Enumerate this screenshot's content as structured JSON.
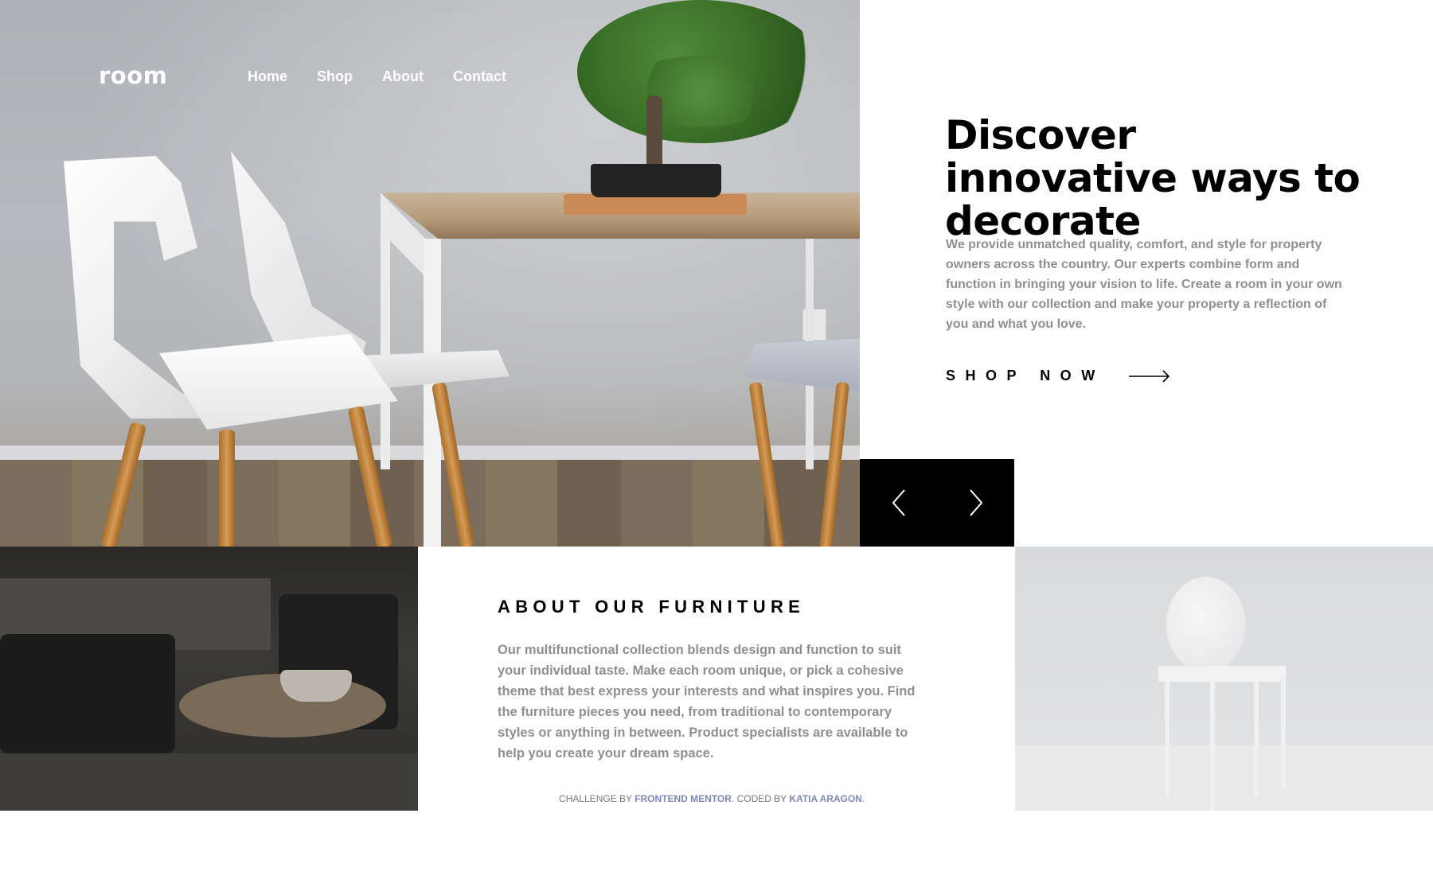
{
  "header": {
    "logo": "room",
    "nav": [
      "Home",
      "Shop",
      "About",
      "Contact"
    ]
  },
  "hero": {
    "title": "Discover innovative ways to decorate",
    "description": "We provide unmatched quality, comfort, and style for property owners across the country. Our experts combine form and function in bringing your vision to life. Create a room in your own style with our collection and make your property a reflection of you and what you love.",
    "cta_label": "SHOP NOW",
    "cta_icon": "arrow-right-icon"
  },
  "slider": {
    "prev_icon": "chevron-left-icon",
    "next_icon": "chevron-right-icon"
  },
  "about": {
    "title": "ABOUT OUR FURNITURE",
    "text": "Our multifunctional collection blends design and function to suit your individual taste. Make each room unique, or pick a cohesive theme that best express your interests and what inspires you. Find the furniture pieces you need, from traditional to contemporary styles or anything in between. Product specialists are available to help you create your dream space."
  },
  "attribution": {
    "prefix": "CHALLENGE BY ",
    "link1": "FRONTEND MENTOR",
    "middle": ". CODED BY ",
    "link2": "KATIA ARAGON",
    "suffix": "."
  },
  "colors": {
    "text_primary": "#000000",
    "text_secondary": "#8f8f8f",
    "link": "#7f88b8",
    "slider_bg": "#000000"
  }
}
